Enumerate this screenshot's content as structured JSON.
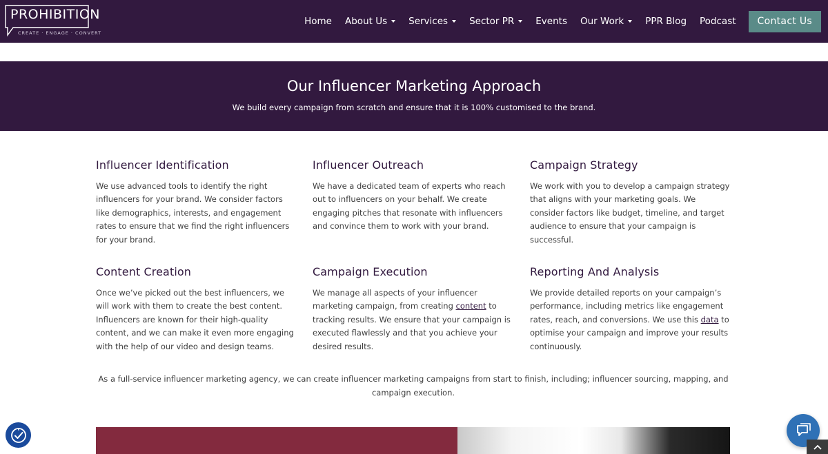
{
  "header": {
    "logo_text": "PROHIBITION",
    "logo_tagline": "CREATE  ·  ENGAGE  ·  CONVERT",
    "nav": [
      {
        "label": "Home",
        "dropdown": false
      },
      {
        "label": "About Us",
        "dropdown": true
      },
      {
        "label": "Services",
        "dropdown": true
      },
      {
        "label": "Sector PR",
        "dropdown": true
      },
      {
        "label": "Events",
        "dropdown": false
      },
      {
        "label": "Our Work",
        "dropdown": true
      },
      {
        "label": "PPR Blog",
        "dropdown": false
      },
      {
        "label": "Podcast",
        "dropdown": false
      }
    ],
    "contact_label": "Contact Us"
  },
  "hero": {
    "title": "Our Influencer Marketing Approach",
    "subtitle": "We build every campaign from scratch and ensure that it is 100% customised to the brand."
  },
  "features": [
    {
      "title": "Influencer Identification",
      "text": "We use advanced tools to identify the right influencers for your brand. We consider factors like demographics, interests, and engagement rates to ensure that we find the right influencers for your brand."
    },
    {
      "title": "Influencer Outreach",
      "text": "We have a dedicated team of experts who reach out to influencers on your behalf. We create engaging pitches that resonate with influencers and convince them to work with your brand."
    },
    {
      "title": "Campaign Strategy",
      "text": "We work with you to develop a campaign strategy that aligns with your marketing goals. We consider factors like budget, timeline, and target audience to ensure that your campaign is successful."
    },
    {
      "title": "Content Creation",
      "text": "Once we’ve picked out the best influencers, we will work with them to create the best content. Influencers are known for their high-quality content, and we can make it even more engaging with the help of our video and design teams."
    },
    {
      "title": "Campaign Execution",
      "text_before": "We manage all aspects of your influencer marketing campaign, from creating ",
      "link": "content",
      "text_after": " to tracking results. We ensure that your campaign is executed flawlessly and that you achieve your desired results."
    },
    {
      "title": "Reporting And Analysis",
      "text_before": "We provide detailed reports on your campaign’s performance, including metrics like engagement rates, reach, and conversions. We use this ",
      "link": "data",
      "text_after": " to optimise your campaign and improve your results continuously."
    }
  ],
  "summary": "As a full-service influencer marketing agency, we can create influencer marketing campaigns from start to finish, including; influencer sourcing, mapping, and campaign execution.",
  "widgets": {
    "accessibility_icon": "accessibility-icon",
    "chat_icon": "chat-bubble-icon",
    "scroll_icon": "chevron-up-icon"
  },
  "colors": {
    "brand_purple": "#32193f",
    "contact_teal": "#5a8b88",
    "image_red": "#832a3e",
    "chat_blue": "#2f71b6"
  }
}
